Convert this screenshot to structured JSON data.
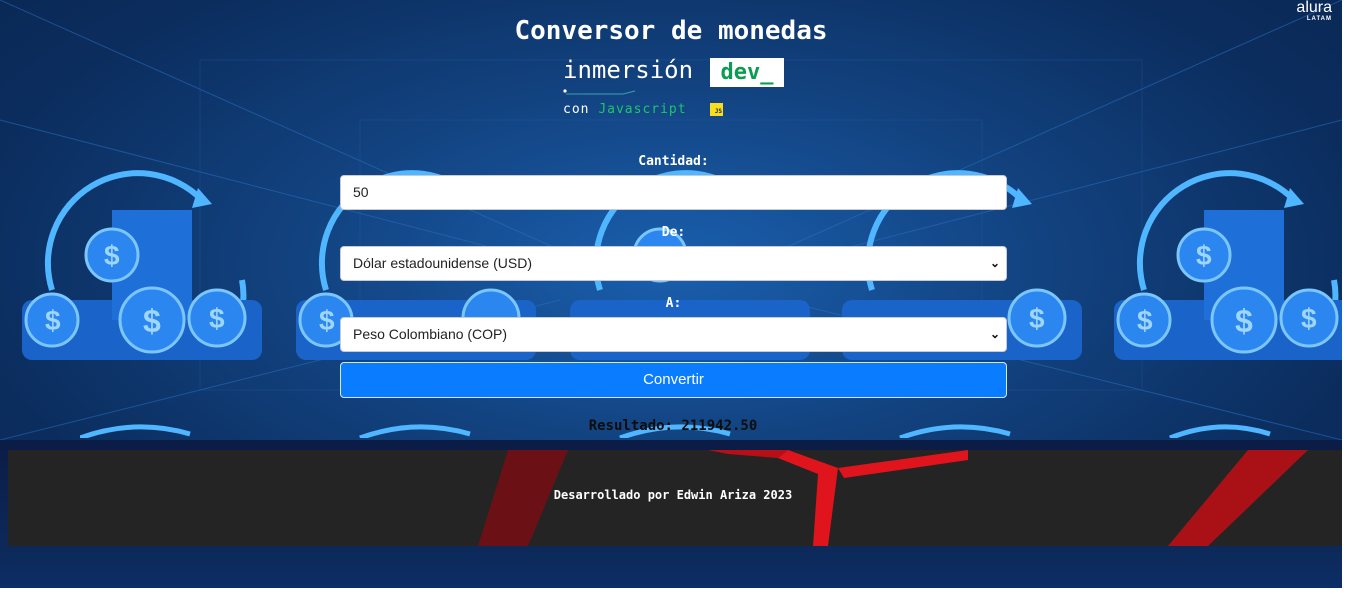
{
  "header": {
    "title": "Conversor de monedas",
    "brand_name": "alura",
    "brand_sub": "LATAM"
  },
  "logo": {
    "word": "inmersión",
    "badge": "dev_",
    "sub_prefix": "con",
    "sub_lang": "Javascript",
    "js_badge": "JS"
  },
  "form": {
    "amount_label": "Cantidad:",
    "amount_value": "50",
    "from_label": "De:",
    "from_selected": "Dólar estadounidense (USD)",
    "to_label": "A:",
    "to_selected": "Peso Colombiano (COP)",
    "convert_label": "Convertir"
  },
  "result": {
    "text": "Resultado: 211942.50"
  },
  "footer": {
    "text": "Desarrollado por Edwin Ariza 2023"
  },
  "colors": {
    "background": "#12427f",
    "button": "#0a7cff",
    "dev_green": "#0c9b52",
    "footer": "#242424",
    "laser_red": "#e0141c"
  },
  "icons": [
    "dollar-coin-icon",
    "refresh-arrow-icon",
    "select-chevron-icon"
  ]
}
